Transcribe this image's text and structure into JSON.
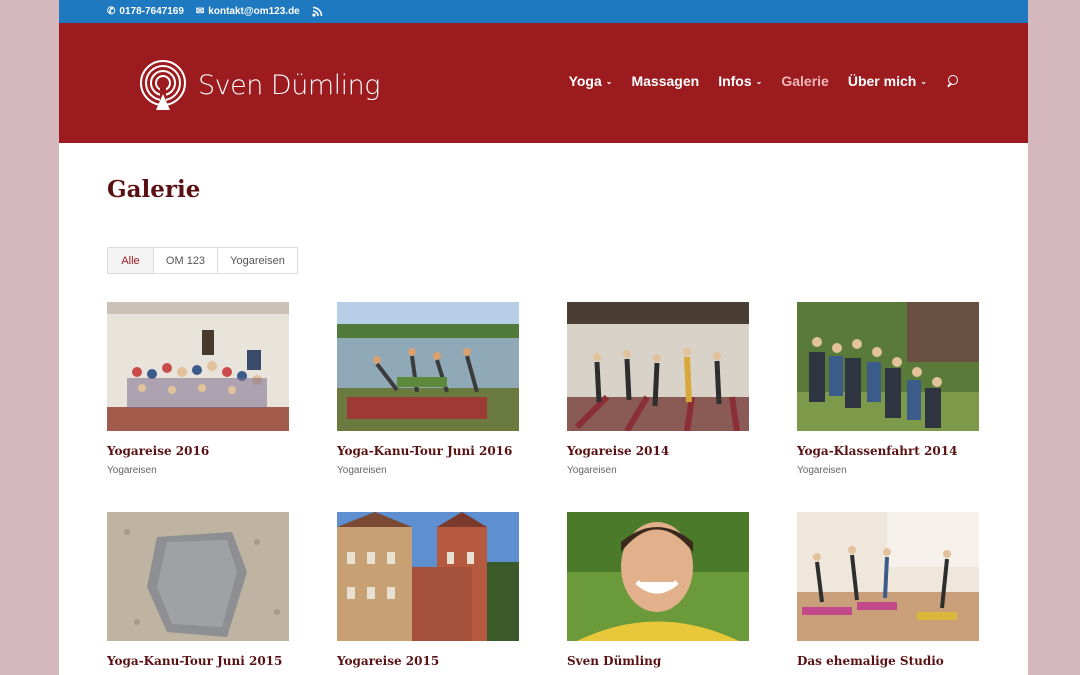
{
  "topbar": {
    "phone": "0178-7647169",
    "email": "kontakt@om123.de"
  },
  "logo": {
    "text": "Sven Dümling"
  },
  "nav": [
    {
      "label": "Yoga",
      "dropdown": true
    },
    {
      "label": "Massagen",
      "dropdown": false
    },
    {
      "label": "Infos",
      "dropdown": true
    },
    {
      "label": "Galerie",
      "dropdown": false,
      "active": true
    },
    {
      "label": "Über mich",
      "dropdown": true
    }
  ],
  "page": {
    "title": "Galerie"
  },
  "filters": [
    {
      "label": "Alle",
      "active": true
    },
    {
      "label": "OM 123"
    },
    {
      "label": "Yogareisen"
    }
  ],
  "gallery": [
    {
      "title": "Yogareise 2016",
      "category": "Yogareisen"
    },
    {
      "title": "Yoga-Kanu-Tour Juni 2016",
      "category": "Yogareisen"
    },
    {
      "title": "Yogareise 2014",
      "category": "Yogareisen"
    },
    {
      "title": "Yoga-Klassenfahrt 2014",
      "category": "Yogareisen"
    },
    {
      "title": "Yoga-Kanu-Tour Juni 2015",
      "category": ""
    },
    {
      "title": "Yogareise 2015",
      "category": ""
    },
    {
      "title": "Sven Dümling",
      "category": ""
    },
    {
      "title": "Das ehemalige Studio",
      "category": ""
    }
  ],
  "colors": {
    "topbar": "#1f79c0",
    "header": "#9b1b1f",
    "title": "#5a1114",
    "background": "#d5b8bd"
  }
}
